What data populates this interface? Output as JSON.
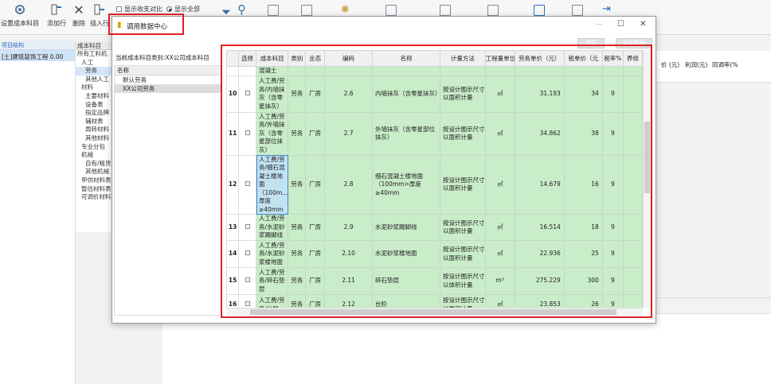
{
  "toolbar": {
    "buttons": [
      {
        "label": "设置成本科目",
        "icon": "settings-icon"
      },
      {
        "label": "添加行",
        "icon": "add-row-icon"
      },
      {
        "label": "删除",
        "icon": "delete-icon"
      },
      {
        "label": "插入行",
        "icon": "insert-row-icon"
      }
    ],
    "checkbox_label": "显示收支对比",
    "radio_label": "显示全部"
  },
  "left": {
    "tab": "项目结构",
    "row": "[土]建筑装饰工程 0.00"
  },
  "tree": {
    "header": "成本科目",
    "nodes": [
      "所有工料机",
      "人工",
      "劳务",
      "其他人工",
      "材料",
      "主要材料",
      "设备表",
      "指定品牌",
      "辅材表",
      "周转材料",
      "其他材料",
      "专业分包",
      "机械",
      "自有/租赁",
      "其他机械",
      "甲供材料表",
      "暂估材料表",
      "可调价材料"
    ]
  },
  "right_headers": {
    "a": "利润(元)",
    "b": "同调率(%",
    "c": "价 (元)"
  },
  "dialog": {
    "title": "调用数据中心",
    "buttons": {
      "select": "选择",
      "apply": "调用数据"
    },
    "current_category_label": "当前成本科目类别:",
    "current_category_value": "XX公司成本科目",
    "list_header": "名称",
    "list_items": [
      "默认劳务",
      "XX公司劳务"
    ],
    "columns": [
      "选择",
      "成本科目",
      "类别",
      "业态",
      "编码",
      "名称",
      "计量方法",
      "工程量单位",
      "劳务单价（元）",
      "税单价（元",
      "税率%",
      "养修"
    ],
    "rows": [
      {
        "no": "",
        "subject": "混凝土",
        "cat": "",
        "biz": "",
        "code": "",
        "name": "",
        "method": "",
        "unit": "",
        "price": "",
        "taxprice": "",
        "rate": ""
      },
      {
        "no": "10",
        "subject": "人工费/劳务/内墙抹灰（含零星抹灰）",
        "cat": "劳务",
        "biz": "厂房",
        "code": "2.6",
        "name": "内墙抹灰（含零星抹灰）",
        "method": "按设计图示尺寸以面积计量",
        "unit": "㎡",
        "price": "31.193",
        "taxprice": "34",
        "rate": "9"
      },
      {
        "no": "11",
        "subject": "人工费/劳务/外墙抹灰（含零星部位抹灰）",
        "cat": "劳务",
        "biz": "厂房",
        "code": "2.7",
        "name": "外墙抹灰（含零星部位抹灰）",
        "method": "按设计图示尺寸以面积计量",
        "unit": "㎡",
        "price": "34.862",
        "taxprice": "38",
        "rate": "9"
      },
      {
        "no": "12",
        "subject": "人工费/劳务/细石混凝土楼地面（100m...厚度≥40mm",
        "cat": "劳务",
        "biz": "厂房",
        "code": "2.8",
        "name": "细石混凝土楼地面（100mm>厚度≥40mm",
        "method": "按设计图示尺寸以面积计量",
        "unit": "㎡",
        "price": "14.679",
        "taxprice": "16",
        "rate": "9"
      },
      {
        "no": "13",
        "subject": "人工费/劳务/水泥砂浆踢脚线",
        "cat": "劳务",
        "biz": "厂房",
        "code": "2.9",
        "name": "水泥砂浆踢脚线",
        "method": "按设计图示尺寸以面积计量",
        "unit": "㎡",
        "price": "16.514",
        "taxprice": "18",
        "rate": "9"
      },
      {
        "no": "14",
        "subject": "人工费/劳务/水泥砂浆楼地面",
        "cat": "劳务",
        "biz": "厂房",
        "code": "2.10",
        "name": "水泥砂浆楼地面",
        "method": "按设计图示尺寸以面积计量",
        "unit": "㎡",
        "price": "22.936",
        "taxprice": "25",
        "rate": "9"
      },
      {
        "no": "15",
        "subject": "人工费/劳务/碎石垫层",
        "cat": "劳务",
        "biz": "厂房",
        "code": "2.11",
        "name": "碎石垫层",
        "method": "按设计图示尺寸以体积计量",
        "unit": "m³",
        "price": "275.229",
        "taxprice": "300",
        "rate": "9"
      },
      {
        "no": "16",
        "subject": "人工费/劳务/台阶",
        "cat": "劳务",
        "biz": "厂房",
        "code": "2.12",
        "name": "台阶",
        "method": "按设计图示尺寸以面积计量",
        "unit": "㎡",
        "price": "23.853",
        "taxprice": "26",
        "rate": "9"
      }
    ]
  }
}
